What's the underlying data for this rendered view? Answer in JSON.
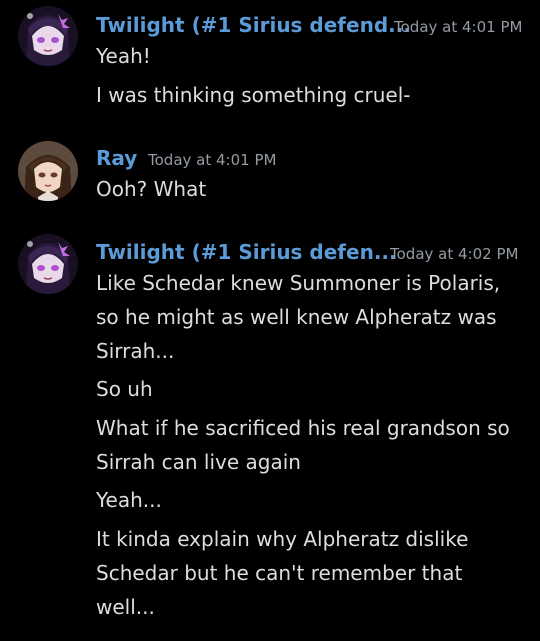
{
  "messages": [
    {
      "username": "Twilight (#1 Sirius defend...",
      "timestamp": "Today at 4:01 PM",
      "avatar": "anime-girl-purple-avatar",
      "username_color": "#5b9bd8",
      "lines": [
        "Yeah!",
        "I was thinking something cruel-"
      ]
    },
    {
      "username": "Ray",
      "timestamp": "Today at 4:01 PM",
      "avatar": "anime-girl-brown-hair-avatar",
      "username_color": "#5b9bd8",
      "lines": [
        "Ooh? What"
      ]
    },
    {
      "username": "Twilight (#1 Sirius defen...",
      "timestamp": "Today at 4:02 PM",
      "avatar": "anime-girl-purple-avatar",
      "username_color": "#5b9bd8",
      "lines": [
        "Like Schedar knew Summoner is Polaris,",
        "so he might as well knew Alpheratz was",
        "Sirrah...",
        "So uh",
        "What if he sacrificed his real grandson so",
        "Sirrah can live again",
        "Yeah...",
        "It kinda explain why Alpheratz dislike",
        "Schedar but he can't remember that",
        "well..."
      ]
    }
  ]
}
